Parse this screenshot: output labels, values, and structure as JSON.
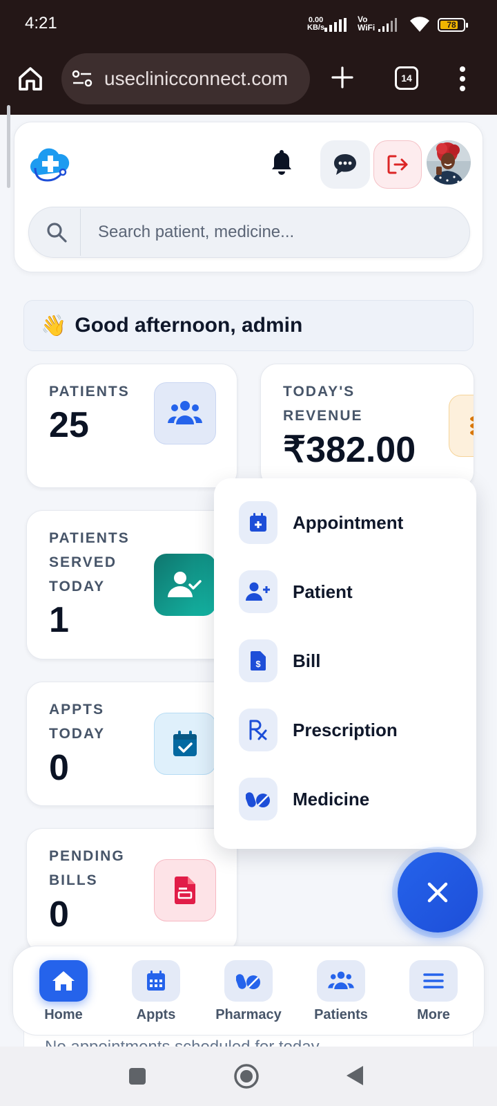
{
  "status_bar": {
    "time": "4:21",
    "net_speed_value": "0.00",
    "net_speed_unit": "KB/s",
    "vowifi": "Vo WiFi",
    "battery": "78",
    "battery_level": 0.78
  },
  "browser": {
    "url": "useclinicconnect.com",
    "tab_count": "14"
  },
  "header": {
    "search_placeholder": "Search patient, medicine..."
  },
  "greeting": {
    "emoji": "👋",
    "text": "Good afternoon, admin"
  },
  "stats": {
    "patients": {
      "label_lines": [
        "PATIENTS"
      ],
      "value": "25"
    },
    "revenue": {
      "label_lines": [
        "TODAY'S",
        "REVENUE"
      ],
      "value": "₹382.00"
    },
    "served": {
      "label_lines": [
        "PATIENTS",
        "SERVED",
        "TODAY"
      ],
      "value": "1"
    },
    "appts": {
      "label_lines": [
        "APPTS",
        "TODAY"
      ],
      "value": "0"
    },
    "bills": {
      "label_lines": [
        "PENDING",
        "BILLS"
      ],
      "value": "0"
    }
  },
  "fab_menu": {
    "items": [
      "Appointment",
      "Patient",
      "Bill",
      "Prescription",
      "Medicine"
    ]
  },
  "peek_text": "No appointments scheduled for today",
  "bottom_nav": {
    "items": [
      "Home",
      "Appts",
      "Pharmacy",
      "Patients",
      "More"
    ],
    "active": "Home"
  },
  "colors": {
    "accent": "#2563eb",
    "served_icon": "#0f9e85",
    "bills_icon": "#e11d48",
    "revenue_icon": "#d97706"
  }
}
